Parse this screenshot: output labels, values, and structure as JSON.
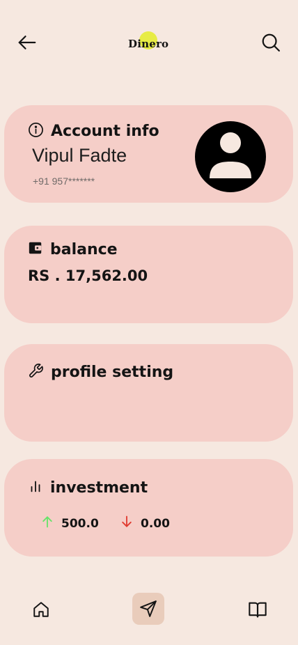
{
  "header": {
    "logo_text": "Dinero"
  },
  "account": {
    "title": "Account info",
    "name": "Vipul Fadte",
    "phone": "+91 957*******"
  },
  "balance": {
    "title": "balance",
    "amount": "RS . 17,562.00"
  },
  "profile": {
    "title": "profile setting"
  },
  "investment": {
    "title": "investment",
    "up_value": "500.0",
    "down_value": "0.00"
  },
  "colors": {
    "background": "#f6e8e0",
    "card": "#f5cec8",
    "logo_dot": "#e6ec3c",
    "up_arrow": "#67e36a",
    "down_arrow": "#e03a2f",
    "active_nav": "#e9ccbb"
  },
  "icons": {
    "back": "arrow-left",
    "search": "search",
    "info": "info-circle",
    "wallet": "wallet",
    "wrench": "wrench",
    "chart": "bar-chart",
    "up": "arrow-up",
    "down": "arrow-down",
    "home": "home",
    "send": "send",
    "book": "book-open"
  }
}
